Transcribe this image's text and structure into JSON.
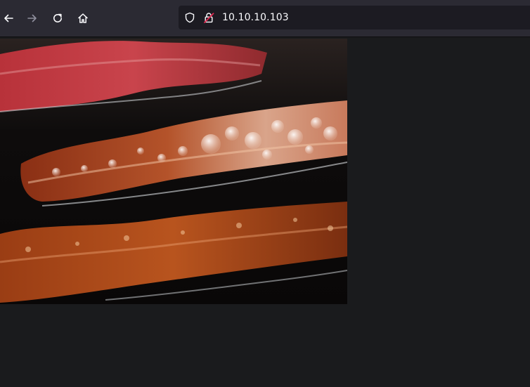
{
  "toolbar": {
    "back_icon": "arrow-left-icon",
    "forward_icon": "arrow-right-icon",
    "reload_icon": "reload-icon",
    "home_icon": "home-icon",
    "shield_icon": "shield-icon",
    "insecure_lock_icon": "insecure-lock-icon"
  },
  "address_bar": {
    "url": "10.10.10.103"
  },
  "page": {
    "image_subject": "image"
  },
  "colors": {
    "toolbar_bg": "#2b2a33",
    "urlbar_bg": "#1c1b22",
    "page_bg": "#1a1b1d",
    "icon_color": "#fbfbfe",
    "disabled_icon": "#8f8f9d",
    "insecure_red": "#e22850"
  }
}
